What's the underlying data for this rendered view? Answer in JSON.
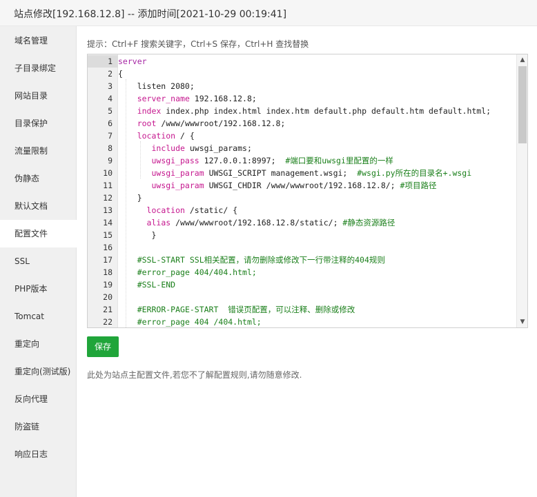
{
  "window": {
    "title": "站点修改[192.168.12.8] -- 添加时间[2021-10-29 00:19:41]"
  },
  "sidebar": {
    "items": [
      {
        "label": "域名管理"
      },
      {
        "label": "子目录绑定"
      },
      {
        "label": "网站目录"
      },
      {
        "label": "目录保护"
      },
      {
        "label": "流量限制"
      },
      {
        "label": "伪静态"
      },
      {
        "label": "默认文档"
      },
      {
        "label": "配置文件",
        "active": true
      },
      {
        "label": "SSL"
      },
      {
        "label": "PHP版本"
      },
      {
        "label": "Tomcat"
      },
      {
        "label": "重定向"
      },
      {
        "label": "重定向(测试版)"
      },
      {
        "label": "反向代理"
      },
      {
        "label": "防盗链"
      },
      {
        "label": "响应日志"
      }
    ]
  },
  "main": {
    "hint": "提示：Ctrl+F 搜索关键字，Ctrl+S 保存，Ctrl+H 查找替换",
    "save_label": "保存",
    "note": "此处为站点主配置文件,若您不了解配置规则,请勿随意修改.",
    "editor": {
      "lines": [
        {
          "n": "1",
          "parts": [
            {
              "t": "server",
              "c": "kw"
            }
          ]
        },
        {
          "n": "2",
          "parts": [
            {
              "t": "{",
              "c": "txt"
            }
          ]
        },
        {
          "n": "3",
          "parts": [
            {
              "t": "    listen 2080;",
              "c": "txt"
            }
          ]
        },
        {
          "n": "4",
          "parts": [
            {
              "t": "    ",
              "c": "txt"
            },
            {
              "t": "server_name",
              "c": "kw2"
            },
            {
              "t": " 192.168.12.8;",
              "c": "txt"
            }
          ]
        },
        {
          "n": "5",
          "parts": [
            {
              "t": "    ",
              "c": "txt"
            },
            {
              "t": "index",
              "c": "kw2"
            },
            {
              "t": " index.php index.html index.htm default.php default.htm default.html;",
              "c": "txt"
            }
          ]
        },
        {
          "n": "6",
          "parts": [
            {
              "t": "    ",
              "c": "txt"
            },
            {
              "t": "root",
              "c": "kw2"
            },
            {
              "t": " /www/wwwroot/192.168.12.8;",
              "c": "txt"
            }
          ]
        },
        {
          "n": "7",
          "parts": [
            {
              "t": "    ",
              "c": "txt"
            },
            {
              "t": "location",
              "c": "kw2"
            },
            {
              "t": " / {",
              "c": "txt"
            }
          ]
        },
        {
          "n": "8",
          "parts": [
            {
              "t": "       ",
              "c": "txt"
            },
            {
              "t": "include",
              "c": "kw2"
            },
            {
              "t": " uwsgi_params;",
              "c": "txt"
            }
          ]
        },
        {
          "n": "9",
          "parts": [
            {
              "t": "       ",
              "c": "txt"
            },
            {
              "t": "uwsgi_pass",
              "c": "kw2"
            },
            {
              "t": " 127.0.0.1:8997;  ",
              "c": "txt"
            },
            {
              "t": "#端口要和uwsgi里配置的一样",
              "c": "cmt"
            }
          ]
        },
        {
          "n": "10",
          "parts": [
            {
              "t": "       ",
              "c": "txt"
            },
            {
              "t": "uwsgi_param",
              "c": "kw2"
            },
            {
              "t": " UWSGI_SCRIPT management.wsgi;  ",
              "c": "txt"
            },
            {
              "t": "#wsgi.py所在的目录名+.wsgi",
              "c": "cmt"
            }
          ]
        },
        {
          "n": "11",
          "parts": [
            {
              "t": "       ",
              "c": "txt"
            },
            {
              "t": "uwsgi_param",
              "c": "kw2"
            },
            {
              "t": " UWSGI_CHDIR /www/wwwroot/192.168.12.8/; ",
              "c": "txt"
            },
            {
              "t": "#项目路径",
              "c": "cmt"
            }
          ]
        },
        {
          "n": "12",
          "parts": [
            {
              "t": "    }",
              "c": "txt"
            }
          ]
        },
        {
          "n": "13",
          "parts": [
            {
              "t": "      ",
              "c": "txt"
            },
            {
              "t": "location",
              "c": "kw2"
            },
            {
              "t": " /static/ {",
              "c": "txt"
            }
          ]
        },
        {
          "n": "14",
          "parts": [
            {
              "t": "      ",
              "c": "txt"
            },
            {
              "t": "alias",
              "c": "kw2"
            },
            {
              "t": " /www/wwwroot/192.168.12.8/static/; ",
              "c": "txt"
            },
            {
              "t": "#静态资源路径",
              "c": "cmt"
            }
          ]
        },
        {
          "n": "15",
          "parts": [
            {
              "t": "       }",
              "c": "txt"
            }
          ]
        },
        {
          "n": "16",
          "parts": [
            {
              "t": "",
              "c": "txt"
            }
          ]
        },
        {
          "n": "17",
          "parts": [
            {
              "t": "    ",
              "c": "txt"
            },
            {
              "t": "#SSL-START SSL相关配置，请勿删除或修改下一行带注释的404规则",
              "c": "cmt"
            }
          ]
        },
        {
          "n": "18",
          "parts": [
            {
              "t": "    ",
              "c": "txt"
            },
            {
              "t": "#error_page 404/404.html;",
              "c": "cmt"
            }
          ]
        },
        {
          "n": "19",
          "parts": [
            {
              "t": "    ",
              "c": "txt"
            },
            {
              "t": "#SSL-END",
              "c": "cmt"
            }
          ]
        },
        {
          "n": "20",
          "parts": [
            {
              "t": "",
              "c": "txt"
            }
          ]
        },
        {
          "n": "21",
          "parts": [
            {
              "t": "    ",
              "c": "txt"
            },
            {
              "t": "#ERROR-PAGE-START  错误页配置，可以注释、删除或修改",
              "c": "cmt"
            }
          ]
        },
        {
          "n": "22",
          "parts": [
            {
              "t": "    ",
              "c": "txt"
            },
            {
              "t": "#error_page 404 /404.html;",
              "c": "cmt"
            }
          ]
        }
      ]
    }
  },
  "colors": {
    "accent": "#20a53a",
    "keyword": "#a626a4",
    "comment": "#1a7f1a"
  }
}
